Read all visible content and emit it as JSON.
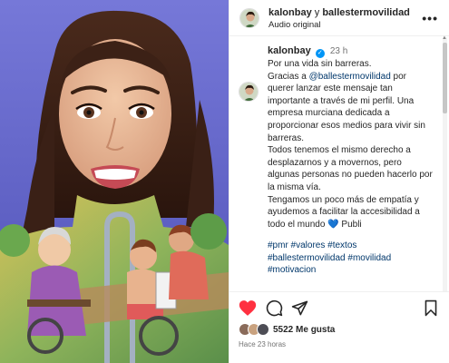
{
  "header": {
    "username": "kalonbay",
    "connector": "y",
    "collaborator": "ballestermovilidad",
    "audio": "Audio original",
    "more_icon": "more-horizontal-icon"
  },
  "caption": {
    "username": "kalonbay",
    "time": "23 h",
    "lines": [
      "Por una vida sin barreras.",
      "Gracias a ",
      "@ballestermovilidad",
      " por querer lanzar este mensaje tan importante a través de mi perfil. Una empresa murciana dedicada a proporcionar esos medios para vivir sin barreras.",
      "Todos tenemos el mismo derecho a desplazarnos y a movernos, pero algunas personas no pueden hacerlo por la misma vía.",
      "Tengamos un poco más de empatía y ayudemos a facilitar la accesibilidad a todo el mundo",
      "💙",
      "  Publi"
    ],
    "hashtags": "#pmr #valores #textos #ballestermovilidad #movilidad #motivacion"
  },
  "actions": {
    "likes": "5522 Me gusta",
    "time_ago": "Hace 23 horas"
  },
  "colors": {
    "link": "#00376b",
    "verified": "#0095f6",
    "like": "#ff3040"
  }
}
